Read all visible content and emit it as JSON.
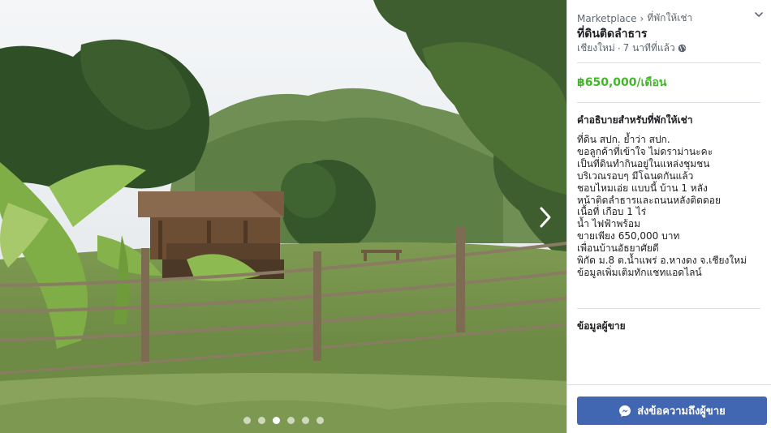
{
  "breadcrumb": {
    "root": "Marketplace",
    "separator": "›",
    "category": "ที่พักให้เช่า"
  },
  "listing": {
    "title": "ที่ดินติดลำธาร",
    "location": "เชียงใหม่",
    "meta_separator": "·",
    "time_posted": "7 นาทีที่แล้ว",
    "price": "฿650,000/เดือน"
  },
  "description": {
    "heading": "คำอธิบายสำหรับที่พักให้เช่า",
    "lines": [
      "ที่ดิน สปก. ย้ำว่า สปก.",
      "ขอลูกค้าที่เข้าใจ ไม่ดราม่านะคะ",
      "เป็นที่ดินทำกินอยู่ในแหล่งชุมชน",
      "บริเวณรอบๆ มีโฉนดกันแล้ว",
      "ชอบไหมเอ่ย แบบนี้ บ้าน 1 หลัง",
      "หน้าติดลำธารและถนนหลังติดดอย",
      "เนื้อที่ เกือบ 1 ไร่",
      "น้ำ ไฟฟ้าพร้อม",
      "ขายเพียง 650,000 บาท",
      "เพื่อนบ้านอัธยาศัยดี",
      "พิกัด ม.8 ต.น้ำแพร่ อ.หางดง จ.เชียงใหม่",
      "ข้อมูลเพิ่มเติมทักแชทแอดไลน์"
    ]
  },
  "seller": {
    "heading": "ข้อมูลผู้ขาย"
  },
  "actions": {
    "message_label": "ส่งข้อความถึงผู้ขาย"
  },
  "carousel": {
    "total": 6,
    "active_index": 2
  },
  "icons": {
    "globe": "globe-icon",
    "next": "chevron-right-icon",
    "menu": "chevron-down-icon",
    "messenger": "messenger-icon"
  },
  "colors": {
    "price": "#42b72a",
    "button": "#4267b2",
    "muted": "#606770",
    "text": "#1c1e21"
  }
}
